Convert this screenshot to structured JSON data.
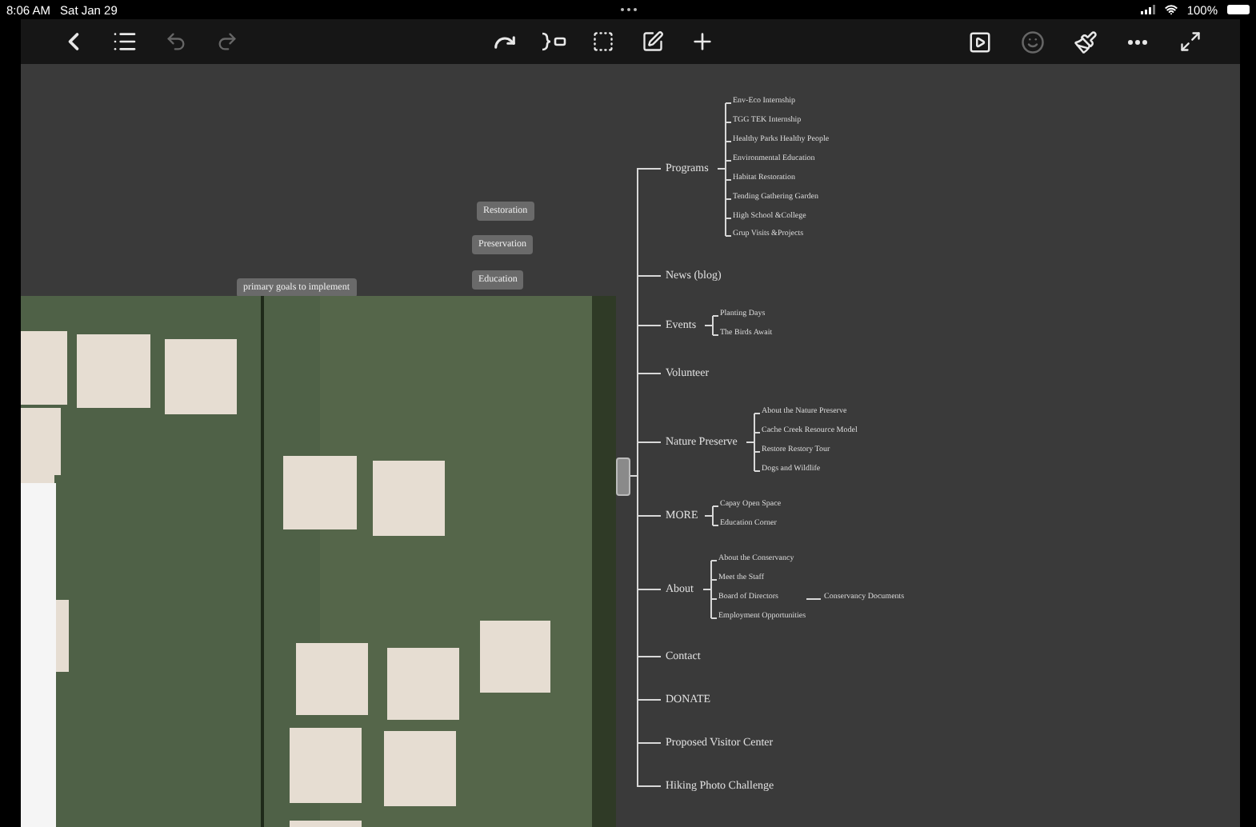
{
  "status_bar": {
    "time": "8:06 AM",
    "date": "Sat Jan 29",
    "battery": "100%"
  },
  "floating_topics": [
    {
      "label": "Restoration"
    },
    {
      "label": "Preservation"
    },
    {
      "label": "Education"
    },
    {
      "label": "primary goals to implement"
    }
  ],
  "mind_map": {
    "topics": [
      {
        "label": "Programs",
        "children": [
          {
            "label": "Env-Eco Internship"
          },
          {
            "label": "TGG TEK Internship"
          },
          {
            "label": "Healthy Parks Healthy People"
          },
          {
            "label": "Environmental Education"
          },
          {
            "label": "Habitat Restoration"
          },
          {
            "label": "Tending Gathering Garden"
          },
          {
            "label": "High School &College"
          },
          {
            "label": "Grup Visits &Projects"
          }
        ]
      },
      {
        "label": "News (blog)"
      },
      {
        "label": "Events",
        "children": [
          {
            "label": "Planting Days"
          },
          {
            "label": "The Birds Await"
          }
        ]
      },
      {
        "label": "Volunteer"
      },
      {
        "label": "Nature Preserve",
        "children": [
          {
            "label": "About the Nature Preserve"
          },
          {
            "label": "Cache Creek Resource Model"
          },
          {
            "label": "Restore Restory Tour"
          },
          {
            "label": "Dogs and Wildlife"
          }
        ]
      },
      {
        "label": "MORE",
        "children": [
          {
            "label": "Capay Open Space"
          },
          {
            "label": "Education Corner"
          }
        ]
      },
      {
        "label": "About",
        "children": [
          {
            "label": "About the Conservancy"
          },
          {
            "label": "Meet the Staff"
          },
          {
            "label": "Board of Directors",
            "children": [
              {
                "label": "Conservancy Documents"
              }
            ]
          },
          {
            "label": "Employment Opportunities"
          }
        ]
      },
      {
        "label": "Contact"
      },
      {
        "label": "DONATE"
      },
      {
        "label": "Proposed Visitor Center"
      },
      {
        "label": "Hiking Photo Challenge"
      }
    ]
  }
}
